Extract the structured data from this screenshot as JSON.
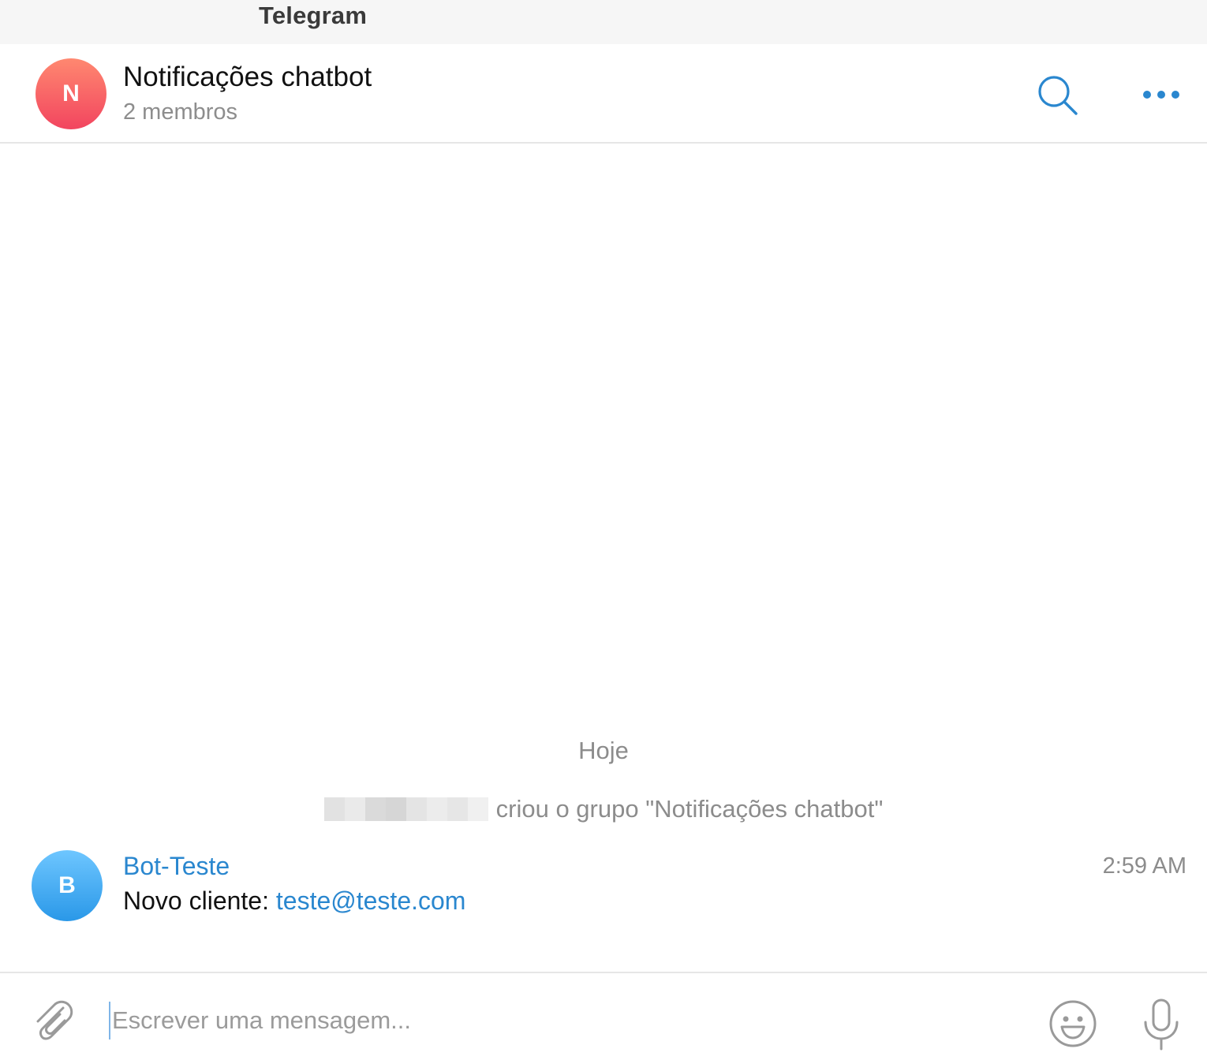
{
  "app": {
    "window_title": "Telegram"
  },
  "header": {
    "avatar_initial": "N",
    "chat_title": "Notificações chatbot",
    "subtitle": "2 membros",
    "search_icon": "search-icon",
    "more_icon": "more-dots-icon"
  },
  "messages": {
    "date_separator": "Hoje",
    "service_message": {
      "author_redacted": true,
      "text": "criou o grupo \"Notificações chatbot\""
    },
    "items": [
      {
        "avatar_initial": "B",
        "sender": "Bot-Teste",
        "time": "2:59 AM",
        "text_prefix": "Novo cliente: ",
        "link": "teste@teste.com"
      }
    ]
  },
  "composer": {
    "placeholder": "Escrever uma mensagem...",
    "value": "",
    "attach_icon": "paperclip-icon",
    "emoji_icon": "smiley-icon",
    "mic_icon": "microphone-icon"
  },
  "colors": {
    "accent": "#2a87cf",
    "group_avatar": "#f2455f",
    "bot_avatar": "#2a98e8",
    "muted_text": "#8c8c8c"
  }
}
